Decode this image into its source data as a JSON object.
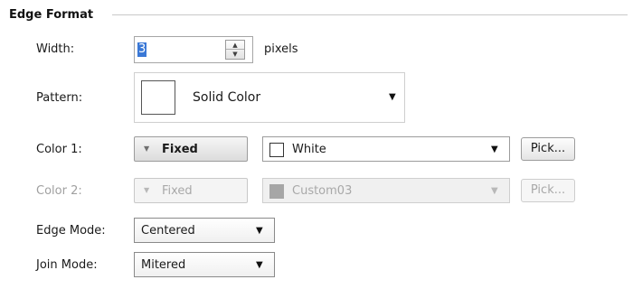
{
  "group": {
    "title": "Edge Format"
  },
  "width": {
    "label": "Width:",
    "value": "3",
    "unit": "pixels"
  },
  "pattern": {
    "label": "Pattern:",
    "value": "Solid Color"
  },
  "color1": {
    "label": "Color 1:",
    "mode": "Fixed",
    "value": "White",
    "swatch_color": "#ffffff",
    "pick_label": "Pick..."
  },
  "color2": {
    "label": "Color 2:",
    "mode": "Fixed",
    "value": "Custom03",
    "swatch_color": "#a6a6a6",
    "pick_label": "Pick...",
    "disabled": true
  },
  "edge_mode": {
    "label": "Edge Mode:",
    "value": "Centered"
  },
  "join_mode": {
    "label": "Join Mode:",
    "value": "Mitered"
  },
  "icons": {
    "dropdown_arrow": "▼",
    "spin_up": "▲",
    "spin_down": "▼"
  },
  "colors": {
    "selection_highlight": "#3a78d6",
    "disabled_text": "#a0a0a0"
  }
}
